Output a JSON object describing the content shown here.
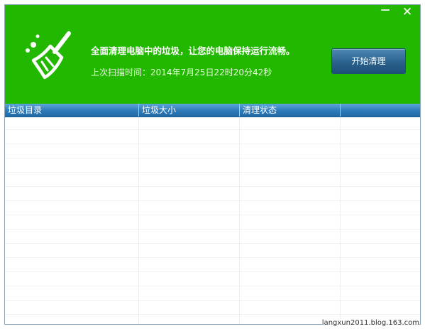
{
  "window": {
    "minimize_glyph": "—",
    "close_glyph": "✕",
    "minimize_icon": "minimize-icon",
    "close_icon": "close-icon"
  },
  "header": {
    "icon": "broom-icon",
    "headline": "全面清理电脑中的垃圾，让您的电脑保持运行流畅。",
    "scan_time": "上次扫描时间：2014年7月25日22时20分42秒",
    "start_button": "开始清理",
    "accent_color": "#22b800"
  },
  "table": {
    "columns": [
      "垃圾目录",
      "垃圾大小",
      "清理状态",
      ""
    ],
    "rows": []
  },
  "watermark": "langxun2011.blog.163.com"
}
